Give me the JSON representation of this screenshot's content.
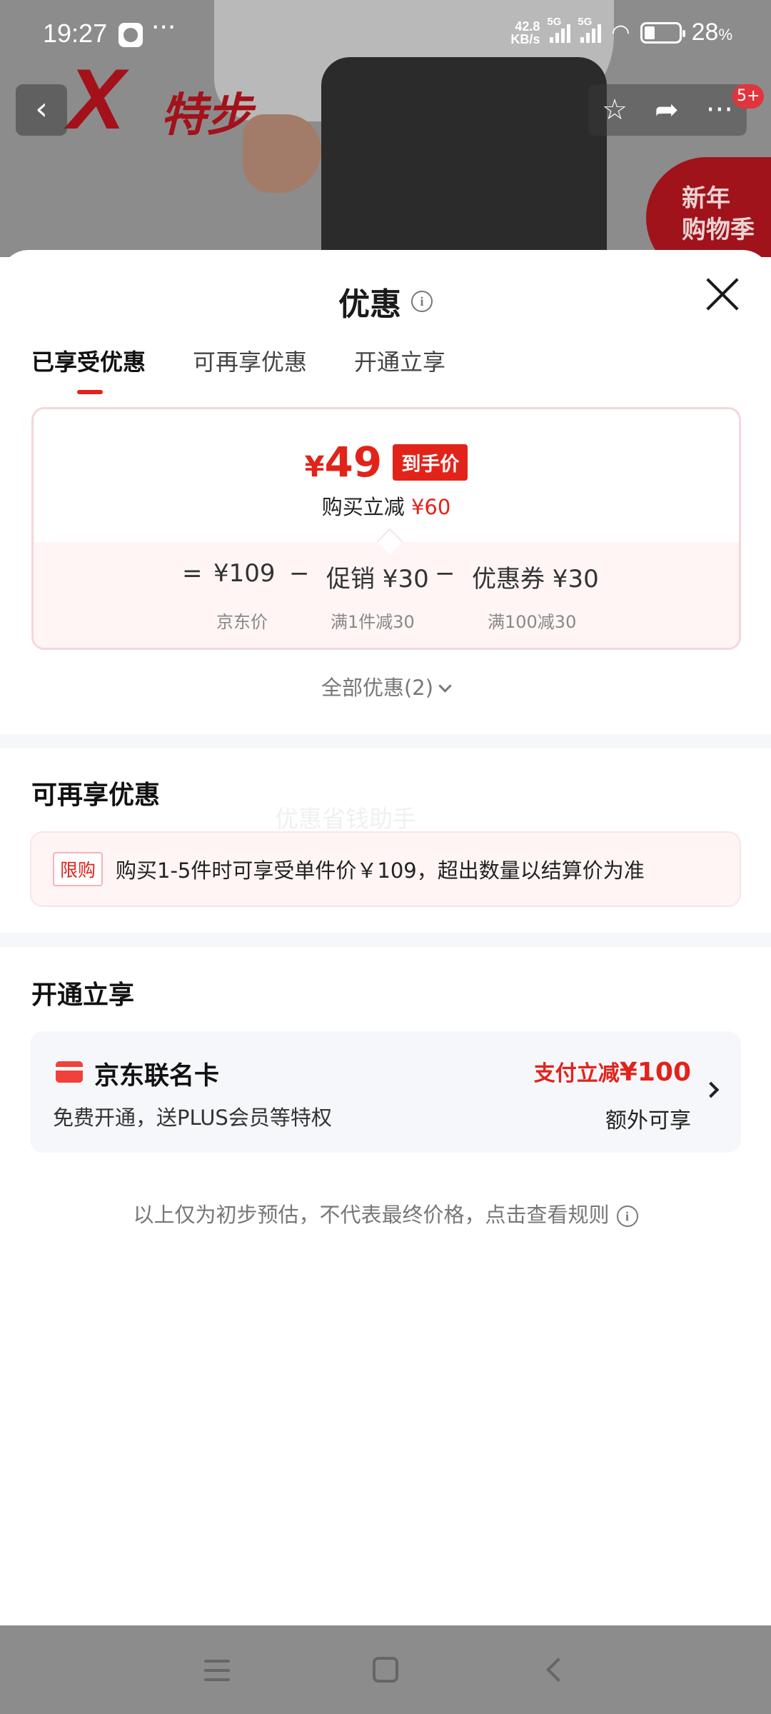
{
  "status_bar": {
    "time": "19:27",
    "more": "···",
    "net_speed_value": "42.8",
    "net_speed_unit": "KB/s",
    "sim1": "5G",
    "sim2": "5G",
    "battery": "28",
    "battery_unit": "%"
  },
  "product_header": {
    "brand_logo_text": "特步",
    "promo_line1": "新年",
    "promo_line2": "购物季",
    "badge": "5+",
    "icons": [
      "back-icon",
      "star-icon",
      "share-icon",
      "more-icon"
    ]
  },
  "sheet": {
    "title": "优惠",
    "info_symbol": "i"
  },
  "tabs": [
    {
      "label": "已享受优惠",
      "active": true
    },
    {
      "label": "可再享优惠",
      "active": false
    },
    {
      "label": "开通立享",
      "active": false
    }
  ],
  "price_box": {
    "currency": "¥",
    "final_price": "49",
    "final_tag": "到手价",
    "reduce_label": "购买立减",
    "reduce_amount": "¥60",
    "eq": "=",
    "minus": "−",
    "jd_price": "¥109",
    "promo": "促销 ¥30",
    "coupon": "优惠券 ¥30",
    "jd_price_label": "京东价",
    "promo_label": "满1件减30",
    "coupon_label": "满100减30"
  },
  "all_discounts": "全部优惠(2)",
  "more_section": {
    "title": "可再享优惠",
    "watermark": "优惠省钱助手",
    "limit_tag": "限购",
    "limit_text": "购买1-5件时可享受单件价￥109，超出数量以结算价为准"
  },
  "open_section": {
    "title": "开通立享",
    "card_name": "京东联名卡",
    "card_desc": "免费开通，送PLUS会员等特权",
    "benefit_prefix": "支付立减",
    "benefit_amount": "¥100",
    "benefit_extra": "额外可享"
  },
  "footnote": "以上仅为初步预估，不代表最终价格，点击查看规则",
  "colors": {
    "accent_red": "#e2231a",
    "divider": "#f6f7fb"
  }
}
